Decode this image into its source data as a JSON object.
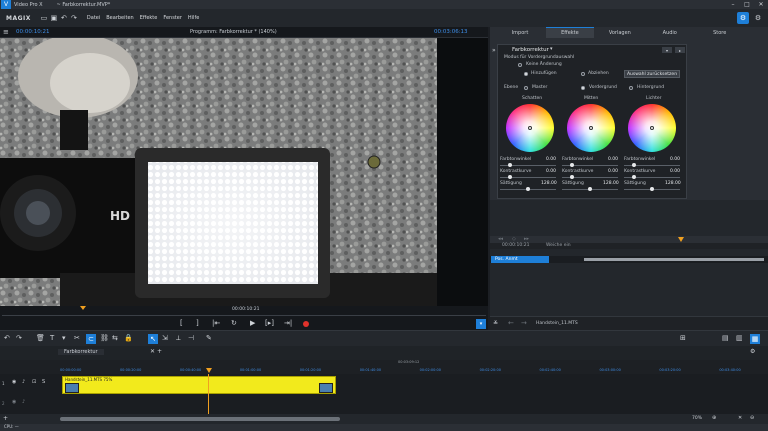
{
  "app": {
    "title": "Video Pro X",
    "file": "~ Farbkorrektur.MVP*"
  },
  "menu": [
    "Datei",
    "Bearbeiten",
    "Effekte",
    "Fenster",
    "Hilfe"
  ],
  "brand": "MAGIX",
  "monitor": {
    "timecode_left": "00:00:10:21",
    "title": "Programm: Farbkorrektur * (140%)",
    "timecode_right": "00:03:06:13",
    "scrub_time": "00:00:10:21"
  },
  "tabs": [
    "Import",
    "Effekte",
    "Vorlagen",
    "Audio",
    "Store"
  ],
  "effect": {
    "name": "Farbkorrektur",
    "mode_title": "Modus für Vordergrundauswahl",
    "opt_none": "Keine Änderung",
    "opt_add": "Hinzufügen",
    "opt_sub": "Abziehen",
    "reset_button": "Auswahl zurücksetzen",
    "level_label": "Ebene",
    "level_master": "Master",
    "level_fg": "Vordergrund",
    "level_bg": "Hintergrund",
    "wheels": [
      {
        "title": "Schatten",
        "lum_label": "Farbtonwinkel",
        "lum_value": "0.00",
        "contrast_label": "Kontrastkurve",
        "contrast_value": "0.00",
        "sat_label": "Sättigung",
        "sat_value": "128.00"
      },
      {
        "title": "Mitten",
        "lum_label": "Farbtonwinkel",
        "lum_value": "0.00",
        "contrast_label": "Kontrastkurve",
        "contrast_value": "0.00",
        "sat_label": "Sättigung",
        "sat_value": "128.00"
      },
      {
        "title": "Lichter",
        "lum_label": "Farbtonwinkel",
        "lum_value": "0.00",
        "contrast_label": "Kontrastkurve",
        "contrast_value": "0.00",
        "sat_label": "Sättigung",
        "sat_value": "128.00"
      }
    ]
  },
  "keyframes": {
    "time": "00:00:10:21",
    "column": "Weiche ein",
    "row": "Pos. Anmt"
  },
  "preview_file": "Handstein_11.MTS",
  "timeline": {
    "tab": "Farbkorrektur",
    "center_time": "00:03:09:12",
    "ticks": [
      "00:00:00:00",
      "00:00:20:00",
      "00:00:40:00",
      "00:01:00:00",
      "00:01:20:00",
      "00:01:40:00",
      "00:02:00:00",
      "00:02:20:00",
      "00:02:40:00",
      "00:03:00:00",
      "00:03:20:00",
      "00:03:40:00",
      "00:04:00:00",
      "00:04:20:00",
      "00:04:40:00",
      "00:05:00:00"
    ],
    "clip_name": "Handstein_11.MTS 75%",
    "zoom": "70%",
    "status": "CPU: —"
  },
  "colors": {
    "accent": "#1e7fd8",
    "clip": "#f2ea1c",
    "record": "#e0322b"
  }
}
